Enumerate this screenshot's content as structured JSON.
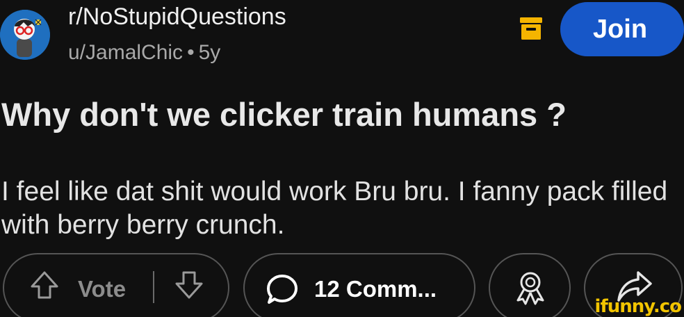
{
  "header": {
    "subreddit": "r/NoStupidQuestions",
    "author": "u/JamalChic",
    "separator": "•",
    "age": "5y",
    "join_label": "Join"
  },
  "post": {
    "title": "Why don't we clicker train humans ?",
    "body": "I feel like dat shit would work Bru bru. I fanny pack filled with berry berry crunch."
  },
  "actions": {
    "vote_label": "Vote",
    "comments_label": "12 Comm..."
  },
  "watermark": "ifunny.co",
  "icons": {
    "avatar": "avatar",
    "archive": "archive-icon",
    "upvote": "upvote-icon",
    "downvote": "downvote-icon",
    "comment": "comment-icon",
    "award": "award-icon",
    "share": "share-icon"
  },
  "colors": {
    "background": "#101010",
    "join_button": "#1757c8",
    "archive_icon": "#f5b400",
    "watermark": "#f2c400"
  }
}
